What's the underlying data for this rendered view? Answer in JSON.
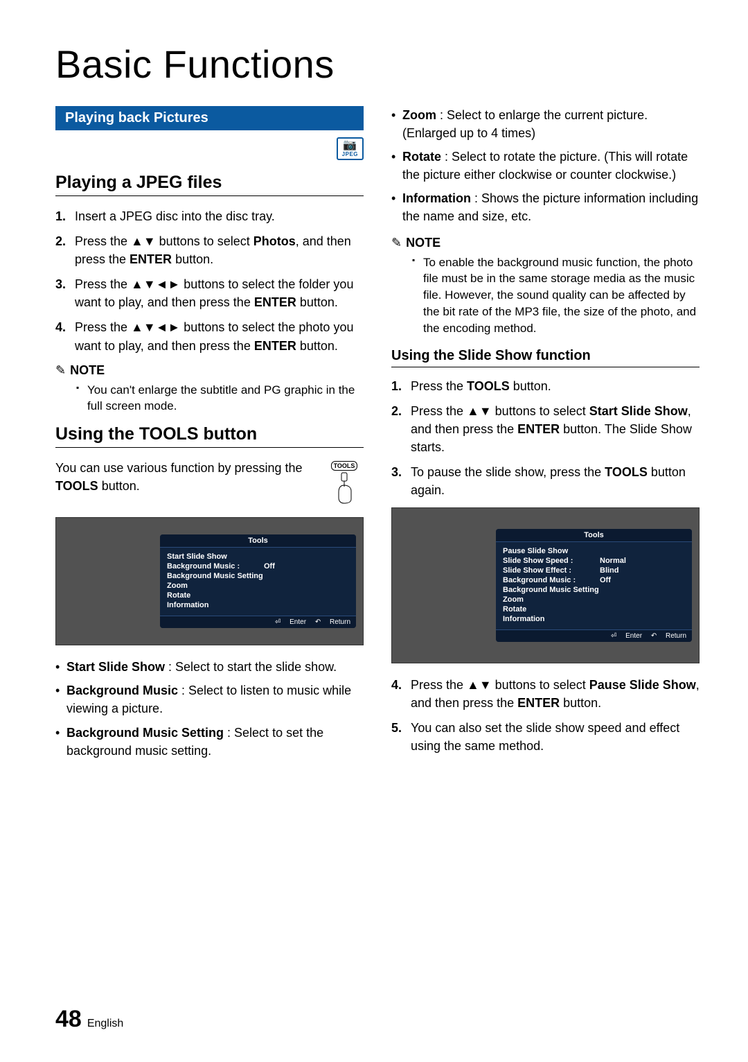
{
  "title": "Basic Functions",
  "banner": "Playing back Pictures",
  "jpeg_badge": {
    "icon": "📷",
    "label": "JPEG"
  },
  "left": {
    "h_play": "Playing a JPEG files",
    "steps_play": [
      "Insert a JPEG disc into the disc tray.",
      "Press the ▲▼ buttons to select <b>Photos</b>, and then press the <b>ENTER</b> button.",
      "Press the ▲▼◄► buttons to select the folder you want to play, and then press the <b>ENTER</b> button.",
      "Press the ▲▼◄► buttons to select the photo you want to play, and then press the <b>ENTER</b> button."
    ],
    "note_label": "NOTE",
    "note_items": [
      "You can't enlarge the subtitle and PG graphic in the full screen mode."
    ],
    "h_tools": "Using the TOOLS button",
    "tools_para": "You can use various function by pressing the <b>TOOLS</b> button.",
    "tools_btn_label": "TOOLS",
    "tv1": {
      "header": "Tools",
      "rows": [
        {
          "label": "Start Slide Show",
          "value": ""
        },
        {
          "label": "Background Music   :",
          "value": "Off"
        },
        {
          "label": "Background Music Setting",
          "value": ""
        },
        {
          "label": "Zoom",
          "value": ""
        },
        {
          "label": "Rotate",
          "value": ""
        },
        {
          "label": "Information",
          "value": ""
        }
      ],
      "foot_enter": "Enter",
      "foot_return": "Return"
    },
    "bullets": [
      "<b>Start Slide Show</b> : Select to start the slide show.",
      "<b>Background Music</b> : Select to listen to music while viewing a picture.",
      "<b>Background Music Setting</b> : Select to set the background music setting."
    ]
  },
  "right": {
    "bullets_top": [
      "<b>Zoom</b> : Select to enlarge the current picture. (Enlarged up to 4 times)",
      "<b>Rotate</b> : Select to rotate the picture. (This will rotate the picture either clockwise or counter clockwise.)",
      "<b>Information</b> : Shows the picture information including the name and size, etc."
    ],
    "note_label": "NOTE",
    "note_items": [
      "To enable the background music function, the photo file must be in the same storage media as the music file. However, the sound quality can be affected by the bit rate of the MP3 file, the size of the photo, and the encoding method."
    ],
    "subhead": "Using the Slide Show function",
    "steps_a": [
      "Press the <b>TOOLS</b> button.",
      "Press the ▲▼ buttons to select <b>Start Slide Show</b>, and then press the <b>ENTER</b> button. The Slide Show starts.",
      "To pause the slide show, press the <b>TOOLS</b> button again."
    ],
    "tv2": {
      "header": "Tools",
      "rows": [
        {
          "label": "Pause Slide Show",
          "value": ""
        },
        {
          "label": "Slide Show Speed   :",
          "value": "Normal"
        },
        {
          "label": "Slide Show Effect    :",
          "value": "Blind"
        },
        {
          "label": "Background Music   :",
          "value": "Off"
        },
        {
          "label": "Background Music Setting",
          "value": ""
        },
        {
          "label": "Zoom",
          "value": ""
        },
        {
          "label": "Rotate",
          "value": ""
        },
        {
          "label": "Information",
          "value": ""
        }
      ],
      "foot_enter": "Enter",
      "foot_return": "Return"
    },
    "steps_b_start": 4,
    "steps_b": [
      "Press the ▲▼ buttons to select <b>Pause Slide Show</b>, and then press the <b>ENTER</b> button.",
      "You can also set the slide show speed and effect using the same method."
    ]
  },
  "footer": {
    "page": "48",
    "lang": "English"
  }
}
